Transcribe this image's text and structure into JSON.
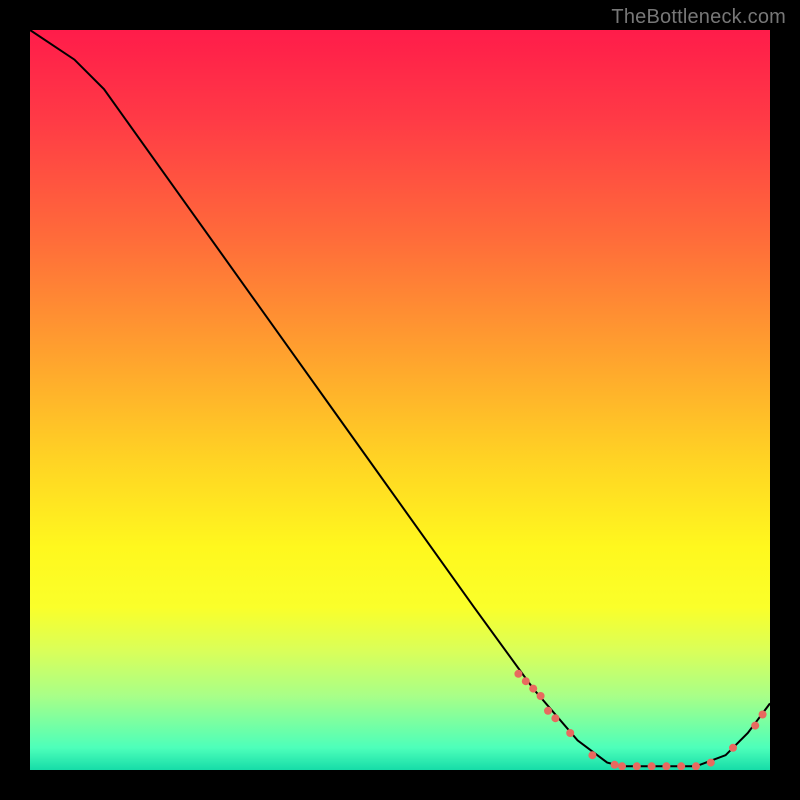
{
  "watermark": "TheBottleneck.com",
  "chart_data": {
    "type": "line",
    "title": "",
    "xlabel": "",
    "ylabel": "",
    "xlim": [
      0,
      100
    ],
    "ylim": [
      0,
      100
    ],
    "grid": false,
    "legend": false,
    "series": [
      {
        "name": "curve",
        "color": "#000000",
        "points": [
          {
            "x": 0,
            "y": 100
          },
          {
            "x": 6,
            "y": 96
          },
          {
            "x": 10,
            "y": 92
          },
          {
            "x": 20,
            "y": 78
          },
          {
            "x": 30,
            "y": 64
          },
          {
            "x": 40,
            "y": 50
          },
          {
            "x": 50,
            "y": 36
          },
          {
            "x": 60,
            "y": 22
          },
          {
            "x": 68,
            "y": 11
          },
          {
            "x": 74,
            "y": 4
          },
          {
            "x": 78,
            "y": 1
          },
          {
            "x": 80,
            "y": 0.5
          },
          {
            "x": 85,
            "y": 0.5
          },
          {
            "x": 90,
            "y": 0.5
          },
          {
            "x": 94,
            "y": 2
          },
          {
            "x": 97,
            "y": 5
          },
          {
            "x": 100,
            "y": 9
          }
        ]
      }
    ],
    "markers": {
      "color": "#e86a5f",
      "radius_px": 4,
      "points": [
        {
          "x": 66,
          "y": 13
        },
        {
          "x": 67,
          "y": 12
        },
        {
          "x": 68,
          "y": 11
        },
        {
          "x": 69,
          "y": 10
        },
        {
          "x": 70,
          "y": 8
        },
        {
          "x": 71,
          "y": 7
        },
        {
          "x": 73,
          "y": 5
        },
        {
          "x": 76,
          "y": 2
        },
        {
          "x": 79,
          "y": 0.7
        },
        {
          "x": 80,
          "y": 0.5
        },
        {
          "x": 82,
          "y": 0.5
        },
        {
          "x": 84,
          "y": 0.5
        },
        {
          "x": 86,
          "y": 0.5
        },
        {
          "x": 88,
          "y": 0.5
        },
        {
          "x": 90,
          "y": 0.5
        },
        {
          "x": 92,
          "y": 1
        },
        {
          "x": 95,
          "y": 3
        },
        {
          "x": 98,
          "y": 6
        },
        {
          "x": 99,
          "y": 7.5
        }
      ]
    }
  }
}
